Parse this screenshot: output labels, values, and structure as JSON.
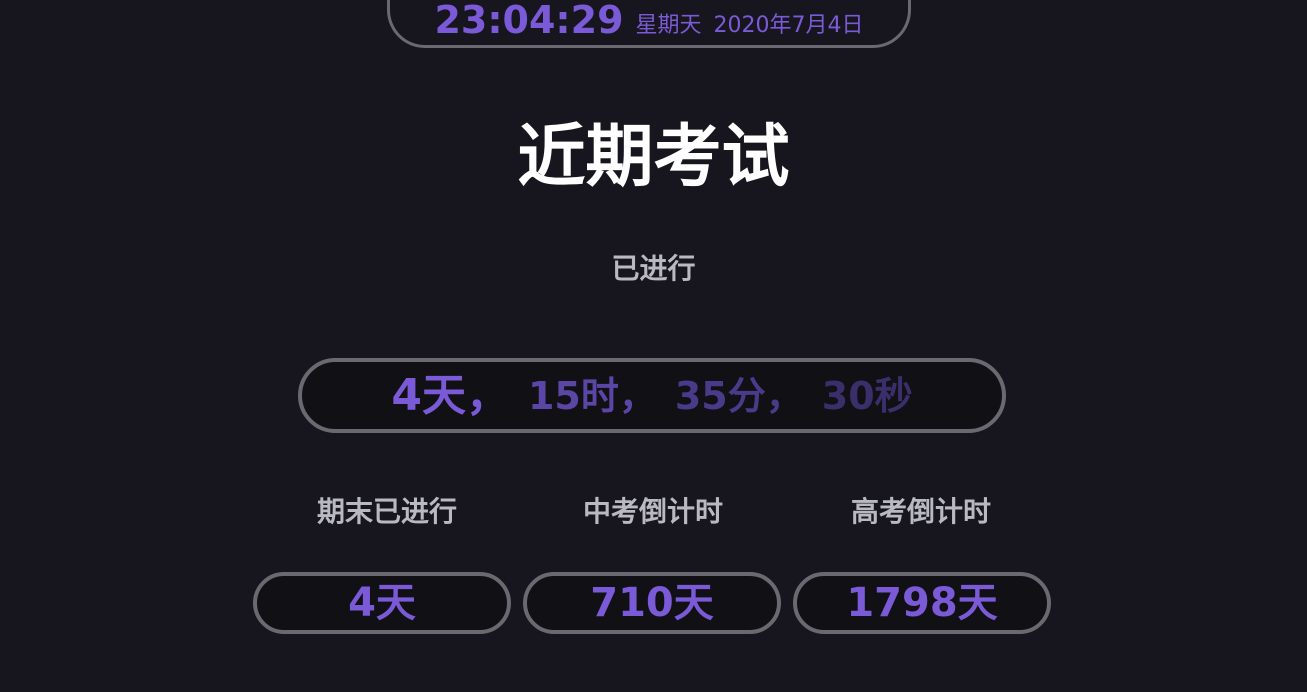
{
  "clock": {
    "time": "23:04:29",
    "weekday": "星期天",
    "date": "2020年7月4日"
  },
  "title": "近期考试",
  "subtitle": "已进行",
  "main_countdown": {
    "days": "4天，",
    "hours": "15时，",
    "minutes": "35分，",
    "seconds": "30秒"
  },
  "cards": [
    {
      "label": "期末已进行",
      "value": "4天"
    },
    {
      "label": "中考倒计时",
      "value": "710天"
    },
    {
      "label": "高考倒计时",
      "value": "1798天"
    }
  ],
  "colors": {
    "background": "#17151e",
    "accent": "#7a5ad6",
    "border": "#6a6870",
    "label": "#b9b9c0"
  }
}
